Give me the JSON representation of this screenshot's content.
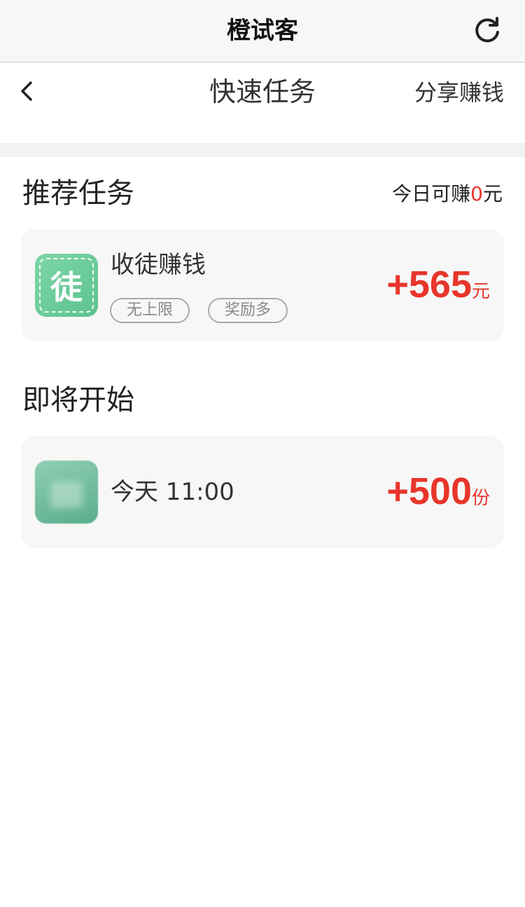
{
  "app_bar": {
    "title": "橙试客",
    "refresh_icon": "refresh-icon"
  },
  "nav": {
    "back_icon": "chevron-left-icon",
    "title": "快速任务",
    "share_label": "分享赚钱"
  },
  "recommended": {
    "title": "推荐任务",
    "earn_prefix": "今日可赚",
    "earn_amount": "0",
    "earn_suffix": "元",
    "task": {
      "icon_char": "徒",
      "name": "收徒赚钱",
      "tags": [
        "无上限",
        "奖励多"
      ],
      "reward_amount": "+565",
      "reward_unit": "元"
    }
  },
  "upcoming": {
    "title": "即将开始",
    "task": {
      "time": "今天 11:00",
      "reward_amount": "+500",
      "reward_unit": "份"
    }
  },
  "colors": {
    "accent": "#e8352b",
    "icon_green": "#6ccc9b",
    "card_bg": "#f7f7f7"
  }
}
